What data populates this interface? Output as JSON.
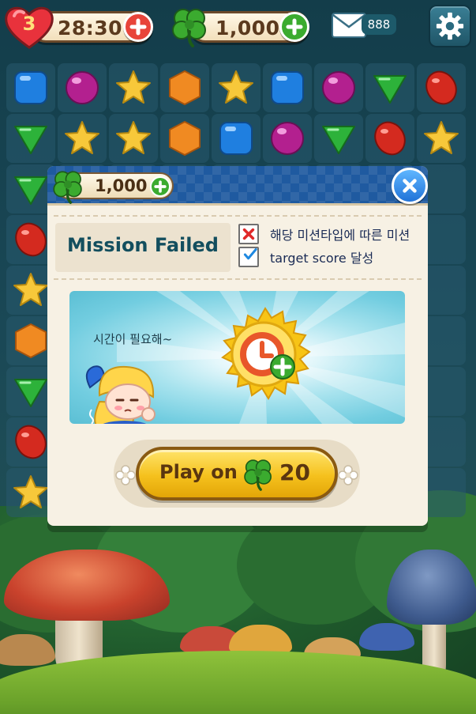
{
  "hud": {
    "lives": {
      "count": "3",
      "timer": "28:30",
      "icon": "heart-icon"
    },
    "clovers": {
      "amount": "1,000",
      "icon": "clover-icon"
    },
    "mail": {
      "count": "888",
      "icon": "mail-icon"
    },
    "settings": {
      "icon": "gear-icon"
    }
  },
  "dialog": {
    "header": {
      "clover_amount": "1,000"
    },
    "title": "Mission Failed",
    "checklist": [
      {
        "label": "해당 미션타입에 따른 미션",
        "state": "failed"
      },
      {
        "label": "target score 달성",
        "state": "passed"
      }
    ],
    "hint_text": "시간이 필요해~",
    "play_button": {
      "label": "Play on",
      "cost": "20"
    }
  },
  "colors": {
    "brand_blue": "#1f5aa0",
    "accent_yellow": "#f5c11d",
    "clover_green": "#3bab2f",
    "heart_red": "#e8323c"
  }
}
